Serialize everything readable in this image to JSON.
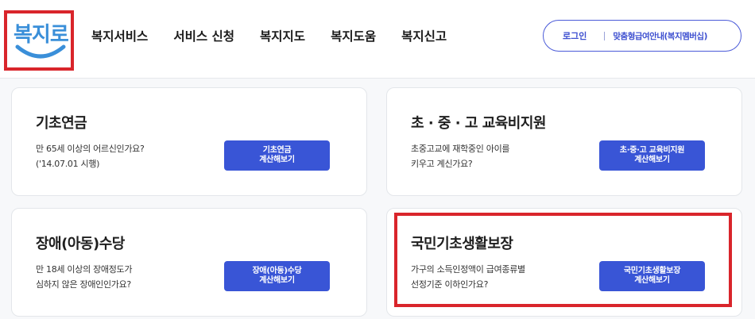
{
  "logo": {
    "text": "복지로"
  },
  "nav": {
    "items": [
      "복지서비스",
      "서비스 신청",
      "복지지도",
      "복지도움",
      "복지신고"
    ]
  },
  "user_menu": {
    "login": "로그인",
    "link": "맞춤형급여안내(복지멤버십)"
  },
  "cards": [
    {
      "title": "기초연금",
      "desc": [
        "만 65세 이상의 어르신인가요?",
        "('14.07.01 시행)"
      ],
      "button": [
        "기초연금",
        "계산해보기"
      ]
    },
    {
      "title": "초 · 중 · 고 교육비지원",
      "desc": [
        "초중고교에 재학중인 아이를",
        "키우고 계신가요?"
      ],
      "button": [
        "초·중·고 교육비지원",
        "계산해보기"
      ]
    },
    {
      "title": "장애(아동)수당",
      "desc": [
        "만 18세 이상의 장애정도가",
        "심하지 않은 장애인인가요?"
      ],
      "button": [
        "장애(아동)수당",
        "계산해보기"
      ]
    },
    {
      "title": "국민기초생활보장",
      "desc": [
        "가구의 소득인정액이 급여종류별",
        "선정기준 이하인가요?"
      ],
      "button": [
        "국민기초생활보장",
        "계산해보기"
      ]
    }
  ],
  "colors": {
    "brand_blue": "#3955d6",
    "logo_blue": "#3a8fd9",
    "highlight_red": "#d9252b"
  }
}
